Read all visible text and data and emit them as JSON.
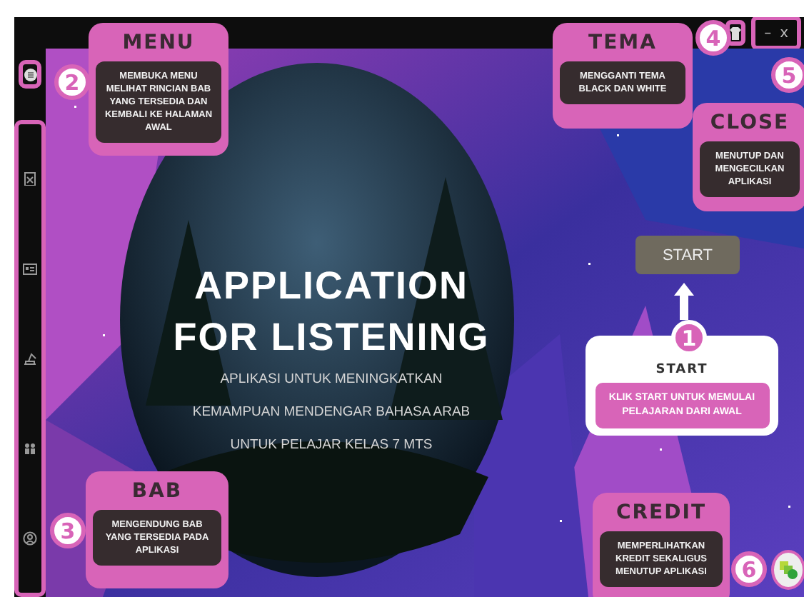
{
  "window": {
    "minimize": "–",
    "close": "x"
  },
  "home": {
    "title_lines": [
      "APPLICATION",
      "FOR LISTENING"
    ],
    "subtitle_lines": [
      "APLIKASI UNTUK MENINGKATKAN",
      "KEMAMPUAN MENDENGAR BAHASA ARAB",
      "UNTUK PELAJAR KELAS 7 MTS"
    ],
    "start_button": "START"
  },
  "callouts": [
    {
      "kind": "card",
      "number": "1",
      "title": "START",
      "text": "KLIK START UNTUK MEMULAI PELAJARAN DARI AWAL"
    },
    {
      "kind": "box",
      "number": "2",
      "title": "MENU",
      "text": "MEMBUKA MENU MELIHAT RINCIAN BAB YANG TERSEDIA DAN KEMBALI KE HALAMAN AWAL"
    },
    {
      "kind": "box",
      "number": "3",
      "title": "BAB",
      "text": "MENGENDUNG BAB YANG TERSEDIA PADA APLIKASI"
    },
    {
      "kind": "box",
      "number": "4",
      "title": "TEMA",
      "text": "MENGGANTI TEMA BLACK DAN WHITE"
    },
    {
      "kind": "box",
      "number": "5",
      "title": "CLOSE",
      "text": "MENUTUP DAN MENGECILKAN APLIKASI"
    },
    {
      "kind": "box",
      "number": "6",
      "title": "CREDIT",
      "text": "MEMPERLIHATKAN KREDIT SEKALIGUS MENUTUP APLIKASI"
    }
  ]
}
